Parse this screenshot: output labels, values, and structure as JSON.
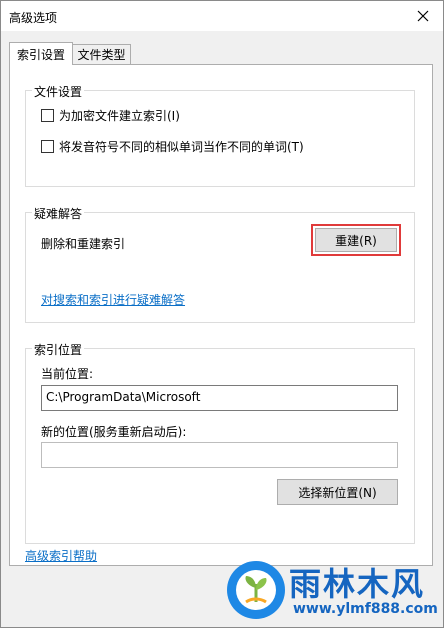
{
  "window": {
    "title": "高级选项"
  },
  "tabs": [
    {
      "label": "索引设置"
    },
    {
      "label": "文件类型"
    }
  ],
  "file_settings": {
    "group_label": "文件设置",
    "options": [
      {
        "label": "为加密文件建立索引(I)",
        "checked": false
      },
      {
        "label": "将发音符号不同的相似单词当作不同的单词(T)",
        "checked": false
      }
    ]
  },
  "troubleshooting": {
    "group_label": "疑难解答",
    "rebuild_text": "删除和重建索引",
    "rebuild_button": "重建(R)",
    "link": "对搜索和索引进行疑难解答"
  },
  "index_location": {
    "group_label": "索引位置",
    "current_label": "当前位置:",
    "current_value": "C:\\ProgramData\\Microsoft",
    "new_label": "新的位置(服务重新启动后):",
    "new_value": "",
    "select_button": "选择新位置(N)"
  },
  "footer": {
    "help_link": "高级索引帮助"
  },
  "watermark": {
    "brand": "雨林木风",
    "url": "www.ylmf888.com"
  },
  "colors": {
    "highlight": "#e03a3a",
    "link": "#0b6fc7",
    "brand": "#1565c0"
  }
}
